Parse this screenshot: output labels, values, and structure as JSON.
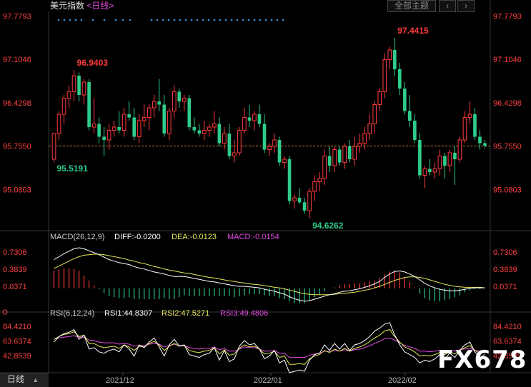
{
  "header": {
    "title": "美元指数",
    "period": "日线",
    "theme_button": "全部主题",
    "arrow_left": "‹",
    "arrow_right": "›"
  },
  "indicators": {
    "macd": {
      "label": "MACD(26,12,9)",
      "diff": "DIFF:-0.0200",
      "dea": "DEA:-0.0123",
      "macd": "MACD:-0.0154"
    },
    "rsi": {
      "label": "RSI(6,12,24)",
      "rsi1": "RSI1:44.8307",
      "rsi2": "RSI2:47.5271",
      "rsi3": "RSI3:49.4806"
    }
  },
  "footer": {
    "period_button": "日线",
    "dropdown_arrow": "▲"
  },
  "watermark": "FX678",
  "colors": {
    "up": "#ff3b3b",
    "down": "#2ecc8a",
    "dea": "#e8e85a",
    "macd_line": "#e44ce4",
    "diff": "#ffffff",
    "ref_line": "#e89a3c",
    "axis_text": "#ff4040",
    "label": "#cccccc"
  },
  "chart_data": {
    "type": "candlestick",
    "main": {
      "y_ticks": [
        "97.7793",
        "97.1046",
        "96.4298",
        "95.7550",
        "95.0803"
      ],
      "ylim": [
        94.45,
        97.85
      ],
      "current_price": 95.755,
      "annotations": [
        {
          "label": "97.4415",
          "index": 68
        },
        {
          "label": "96.9403",
          "index": 4
        },
        {
          "label": "95.5191",
          "index": 0
        },
        {
          "label": "94.6262",
          "index": 51
        }
      ],
      "candles": [
        {
          "o": 95.55,
          "h": 95.62,
          "l": 95.5,
          "c": 95.95
        },
        {
          "o": 95.95,
          "h": 96.3,
          "l": 95.85,
          "c": 96.25
        },
        {
          "o": 96.25,
          "h": 96.55,
          "l": 96.1,
          "c": 96.5
        },
        {
          "o": 96.5,
          "h": 96.7,
          "l": 96.35,
          "c": 96.6
        },
        {
          "o": 96.6,
          "h": 96.94,
          "l": 96.45,
          "c": 96.85
        },
        {
          "o": 96.85,
          "h": 96.9,
          "l": 96.45,
          "c": 96.55
        },
        {
          "o": 96.55,
          "h": 96.8,
          "l": 96.4,
          "c": 96.75
        },
        {
          "o": 96.75,
          "h": 96.8,
          "l": 96.0,
          "c": 96.05
        },
        {
          "o": 96.05,
          "h": 96.5,
          "l": 95.95,
          "c": 96.1
        },
        {
          "o": 96.1,
          "h": 96.2,
          "l": 95.8,
          "c": 95.9
        },
        {
          "o": 95.9,
          "h": 96.05,
          "l": 95.6,
          "c": 95.85
        },
        {
          "o": 95.85,
          "h": 96.1,
          "l": 95.7,
          "c": 96.0
        },
        {
          "o": 96.0,
          "h": 96.15,
          "l": 95.9,
          "c": 96.05
        },
        {
          "o": 96.05,
          "h": 96.3,
          "l": 95.95,
          "c": 96.0
        },
        {
          "o": 96.0,
          "h": 96.35,
          "l": 95.9,
          "c": 96.25
        },
        {
          "o": 96.25,
          "h": 96.45,
          "l": 96.15,
          "c": 96.2
        },
        {
          "o": 96.2,
          "h": 96.35,
          "l": 95.85,
          "c": 95.9
        },
        {
          "o": 95.9,
          "h": 96.25,
          "l": 95.8,
          "c": 96.15
        },
        {
          "o": 96.15,
          "h": 96.4,
          "l": 96.05,
          "c": 96.2
        },
        {
          "o": 96.2,
          "h": 96.4,
          "l": 96.0,
          "c": 96.35
        },
        {
          "o": 96.35,
          "h": 96.55,
          "l": 96.2,
          "c": 96.45
        },
        {
          "o": 96.45,
          "h": 96.8,
          "l": 96.3,
          "c": 96.4
        },
        {
          "o": 96.4,
          "h": 96.55,
          "l": 95.9,
          "c": 95.95
        },
        {
          "o": 95.95,
          "h": 96.35,
          "l": 95.85,
          "c": 96.3
        },
        {
          "o": 96.3,
          "h": 96.7,
          "l": 96.2,
          "c": 96.6
        },
        {
          "o": 96.6,
          "h": 96.65,
          "l": 96.35,
          "c": 96.45
        },
        {
          "o": 96.45,
          "h": 96.55,
          "l": 96.3,
          "c": 96.5
        },
        {
          "o": 96.5,
          "h": 96.55,
          "l": 96.0,
          "c": 96.05
        },
        {
          "o": 96.05,
          "h": 96.2,
          "l": 95.95,
          "c": 96.0
        },
        {
          "o": 96.0,
          "h": 96.1,
          "l": 95.9,
          "c": 95.95
        },
        {
          "o": 95.95,
          "h": 96.15,
          "l": 95.85,
          "c": 96.0
        },
        {
          "o": 96.0,
          "h": 96.1,
          "l": 95.9,
          "c": 96.05
        },
        {
          "o": 96.05,
          "h": 96.3,
          "l": 95.95,
          "c": 96.1
        },
        {
          "o": 96.1,
          "h": 96.2,
          "l": 95.75,
          "c": 95.8
        },
        {
          "o": 95.8,
          "h": 96.05,
          "l": 95.7,
          "c": 95.95
        },
        {
          "o": 95.95,
          "h": 96.1,
          "l": 95.55,
          "c": 95.6
        },
        {
          "o": 95.6,
          "h": 95.85,
          "l": 95.5,
          "c": 95.65
        },
        {
          "o": 95.65,
          "h": 96.05,
          "l": 95.6,
          "c": 96.0
        },
        {
          "o": 96.0,
          "h": 96.35,
          "l": 95.95,
          "c": 96.2
        },
        {
          "o": 96.2,
          "h": 96.4,
          "l": 96.05,
          "c": 96.15
        },
        {
          "o": 96.15,
          "h": 96.3,
          "l": 96.0,
          "c": 96.25
        },
        {
          "o": 96.25,
          "h": 96.4,
          "l": 96.05,
          "c": 96.1
        },
        {
          "o": 96.1,
          "h": 96.25,
          "l": 95.65,
          "c": 95.7
        },
        {
          "o": 95.7,
          "h": 95.8,
          "l": 95.6,
          "c": 95.75
        },
        {
          "o": 95.75,
          "h": 95.95,
          "l": 95.65,
          "c": 95.85
        },
        {
          "o": 95.85,
          "h": 95.9,
          "l": 95.45,
          "c": 95.5
        },
        {
          "o": 95.5,
          "h": 95.6,
          "l": 95.4,
          "c": 95.55
        },
        {
          "o": 95.55,
          "h": 95.6,
          "l": 94.85,
          "c": 94.9
        },
        {
          "o": 94.9,
          "h": 95.0,
          "l": 94.78,
          "c": 94.95
        },
        {
          "o": 94.95,
          "h": 95.1,
          "l": 94.85,
          "c": 94.88
        },
        {
          "o": 94.88,
          "h": 94.95,
          "l": 94.7,
          "c": 94.75
        },
        {
          "o": 94.75,
          "h": 95.1,
          "l": 94.63,
          "c": 95.05
        },
        {
          "o": 95.05,
          "h": 95.3,
          "l": 94.9,
          "c": 95.2
        },
        {
          "o": 95.2,
          "h": 95.35,
          "l": 95.05,
          "c": 95.25
        },
        {
          "o": 95.25,
          "h": 95.7,
          "l": 95.15,
          "c": 95.6
        },
        {
          "o": 95.6,
          "h": 95.75,
          "l": 95.35,
          "c": 95.45
        },
        {
          "o": 95.45,
          "h": 95.75,
          "l": 95.35,
          "c": 95.7
        },
        {
          "o": 95.7,
          "h": 95.75,
          "l": 95.45,
          "c": 95.5
        },
        {
          "o": 95.5,
          "h": 95.8,
          "l": 95.4,
          "c": 95.75
        },
        {
          "o": 95.75,
          "h": 95.85,
          "l": 95.5,
          "c": 95.55
        },
        {
          "o": 95.55,
          "h": 95.9,
          "l": 95.45,
          "c": 95.75
        },
        {
          "o": 95.75,
          "h": 95.95,
          "l": 95.65,
          "c": 95.8
        },
        {
          "o": 95.8,
          "h": 96.05,
          "l": 95.7,
          "c": 95.95
        },
        {
          "o": 95.95,
          "h": 96.25,
          "l": 95.85,
          "c": 96.1
        },
        {
          "o": 96.1,
          "h": 96.45,
          "l": 95.95,
          "c": 96.4
        },
        {
          "o": 96.4,
          "h": 96.65,
          "l": 96.3,
          "c": 96.6
        },
        {
          "o": 96.6,
          "h": 97.2,
          "l": 96.5,
          "c": 97.1
        },
        {
          "o": 97.1,
          "h": 97.3,
          "l": 96.95,
          "c": 97.25
        },
        {
          "o": 97.25,
          "h": 97.44,
          "l": 96.85,
          "c": 96.95
        },
        {
          "o": 96.95,
          "h": 97.05,
          "l": 96.55,
          "c": 96.65
        },
        {
          "o": 96.65,
          "h": 96.75,
          "l": 96.25,
          "c": 96.3
        },
        {
          "o": 96.3,
          "h": 96.55,
          "l": 96.05,
          "c": 96.15
        },
        {
          "o": 96.15,
          "h": 96.25,
          "l": 95.8,
          "c": 95.85
        },
        {
          "o": 95.85,
          "h": 95.95,
          "l": 95.25,
          "c": 95.3
        },
        {
          "o": 95.3,
          "h": 95.45,
          "l": 95.1,
          "c": 95.4
        },
        {
          "o": 95.4,
          "h": 95.55,
          "l": 95.3,
          "c": 95.35
        },
        {
          "o": 95.35,
          "h": 95.5,
          "l": 95.25,
          "c": 95.4
        },
        {
          "o": 95.4,
          "h": 95.7,
          "l": 95.3,
          "c": 95.6
        },
        {
          "o": 95.6,
          "h": 95.65,
          "l": 95.25,
          "c": 95.45
        },
        {
          "o": 95.45,
          "h": 95.7,
          "l": 95.35,
          "c": 95.65
        },
        {
          "o": 95.65,
          "h": 95.75,
          "l": 95.15,
          "c": 95.55
        },
        {
          "o": 95.55,
          "h": 95.9,
          "l": 95.5,
          "c": 95.85
        },
        {
          "o": 95.85,
          "h": 96.3,
          "l": 95.8,
          "c": 96.2
        },
        {
          "o": 96.2,
          "h": 96.45,
          "l": 96.1,
          "c": 96.25
        },
        {
          "o": 96.25,
          "h": 96.35,
          "l": 95.85,
          "c": 95.9
        },
        {
          "o": 95.9,
          "h": 96.0,
          "l": 95.7,
          "c": 95.8
        },
        {
          "o": 95.8,
          "h": 95.85,
          "l": 95.72,
          "c": 95.76
        }
      ]
    },
    "macd": {
      "y_ticks": [
        "0.7306",
        "0.3839",
        "0.0371"
      ],
      "ylim": [
        -0.35,
        0.95
      ],
      "diff": [
        0.58,
        0.64,
        0.7,
        0.75,
        0.8,
        0.82,
        0.8,
        0.76,
        0.72,
        0.68,
        0.63,
        0.58,
        0.55,
        0.52,
        0.5,
        0.48,
        0.44,
        0.41,
        0.39,
        0.36,
        0.33,
        0.31,
        0.29,
        0.26,
        0.24,
        0.24,
        0.24,
        0.22,
        0.2,
        0.18,
        0.16,
        0.14,
        0.13,
        0.11,
        0.09,
        0.07,
        0.05,
        0.04,
        0.04,
        0.03,
        0.02,
        0.01,
        -0.02,
        -0.04,
        -0.06,
        -0.09,
        -0.12,
        -0.17,
        -0.21,
        -0.24,
        -0.26,
        -0.25,
        -0.22,
        -0.19,
        -0.16,
        -0.13,
        -0.11,
        -0.08,
        -0.06,
        -0.05,
        -0.03,
        -0.01,
        0.02,
        0.05,
        0.09,
        0.14,
        0.22,
        0.29,
        0.34,
        0.35,
        0.33,
        0.29,
        0.24,
        0.17,
        0.1,
        0.05,
        0.01,
        -0.02,
        -0.04,
        -0.05,
        -0.05,
        -0.04,
        -0.02,
        0.0,
        0.01,
        0.01,
        0.01
      ],
      "dea": [
        0.4,
        0.45,
        0.5,
        0.55,
        0.6,
        0.64,
        0.67,
        0.68,
        0.69,
        0.69,
        0.68,
        0.66,
        0.64,
        0.62,
        0.6,
        0.57,
        0.55,
        0.52,
        0.5,
        0.47,
        0.44,
        0.42,
        0.39,
        0.37,
        0.35,
        0.33,
        0.31,
        0.3,
        0.28,
        0.26,
        0.24,
        0.22,
        0.21,
        0.19,
        0.17,
        0.15,
        0.14,
        0.12,
        0.11,
        0.09,
        0.08,
        0.07,
        0.05,
        0.04,
        0.02,
        0.01,
        -0.01,
        -0.04,
        -0.06,
        -0.09,
        -0.11,
        -0.12,
        -0.13,
        -0.13,
        -0.13,
        -0.13,
        -0.12,
        -0.11,
        -0.1,
        -0.09,
        -0.08,
        -0.06,
        -0.04,
        -0.02,
        0.01,
        0.04,
        0.08,
        0.12,
        0.16,
        0.19,
        0.22,
        0.23,
        0.23,
        0.22,
        0.2,
        0.17,
        0.14,
        0.11,
        0.08,
        0.06,
        0.04,
        0.03,
        0.02,
        0.02,
        0.02,
        0.02,
        0.01
      ]
    },
    "rsi": {
      "y_ticks": [
        "84.4210",
        "63.6374",
        "42.8539"
      ],
      "ylim": [
        18,
        98
      ],
      "rsi1": [
        62,
        70,
        74,
        76,
        80,
        66,
        72,
        52,
        54,
        48,
        46,
        50,
        52,
        48,
        58,
        52,
        42,
        58,
        54,
        62,
        68,
        55,
        42,
        58,
        66,
        56,
        58,
        44,
        42,
        40,
        44,
        46,
        54,
        36,
        50,
        34,
        38,
        56,
        64,
        58,
        60,
        52,
        38,
        42,
        50,
        32,
        36,
        18,
        20,
        22,
        20,
        36,
        44,
        46,
        58,
        50,
        60,
        52,
        60,
        50,
        58,
        60,
        64,
        70,
        78,
        82,
        88,
        90,
        72,
        58,
        48,
        44,
        40,
        32,
        36,
        34,
        38,
        44,
        38,
        46,
        40,
        50,
        58,
        62,
        48,
        40,
        44
      ],
      "rsi2": [
        66,
        70,
        73,
        74,
        77,
        70,
        72,
        60,
        60,
        56,
        54,
        55,
        56,
        53,
        58,
        55,
        50,
        56,
        55,
        60,
        63,
        58,
        50,
        56,
        60,
        56,
        57,
        50,
        48,
        47,
        49,
        50,
        54,
        45,
        51,
        43,
        45,
        53,
        58,
        55,
        56,
        52,
        45,
        46,
        49,
        40,
        42,
        30,
        30,
        31,
        30,
        38,
        42,
        44,
        50,
        47,
        52,
        49,
        53,
        49,
        53,
        55,
        58,
        63,
        68,
        72,
        78,
        80,
        70,
        62,
        55,
        52,
        48,
        42,
        43,
        42,
        44,
        47,
        44,
        48,
        45,
        50,
        54,
        57,
        50,
        46,
        47
      ],
      "rsi3": [
        66,
        68,
        69,
        70,
        71,
        69,
        69,
        65,
        64,
        62,
        61,
        61,
        61,
        59,
        60,
        59,
        56,
        57,
        57,
        59,
        60,
        59,
        55,
        57,
        59,
        57,
        57,
        54,
        53,
        52,
        53,
        53,
        55,
        51,
        53,
        49,
        49,
        52,
        55,
        54,
        54,
        52,
        49,
        49,
        50,
        46,
        46,
        40,
        40,
        40,
        40,
        43,
        45,
        46,
        49,
        48,
        50,
        49,
        51,
        49,
        51,
        52,
        54,
        57,
        60,
        63,
        67,
        68,
        65,
        61,
        57,
        55,
        53,
        49,
        49,
        48,
        49,
        50,
        49,
        50,
        49,
        51,
        52,
        53,
        50,
        49,
        49
      ]
    },
    "x_labels": [
      "2021/12",
      "2022/01",
      "2022/02"
    ]
  }
}
